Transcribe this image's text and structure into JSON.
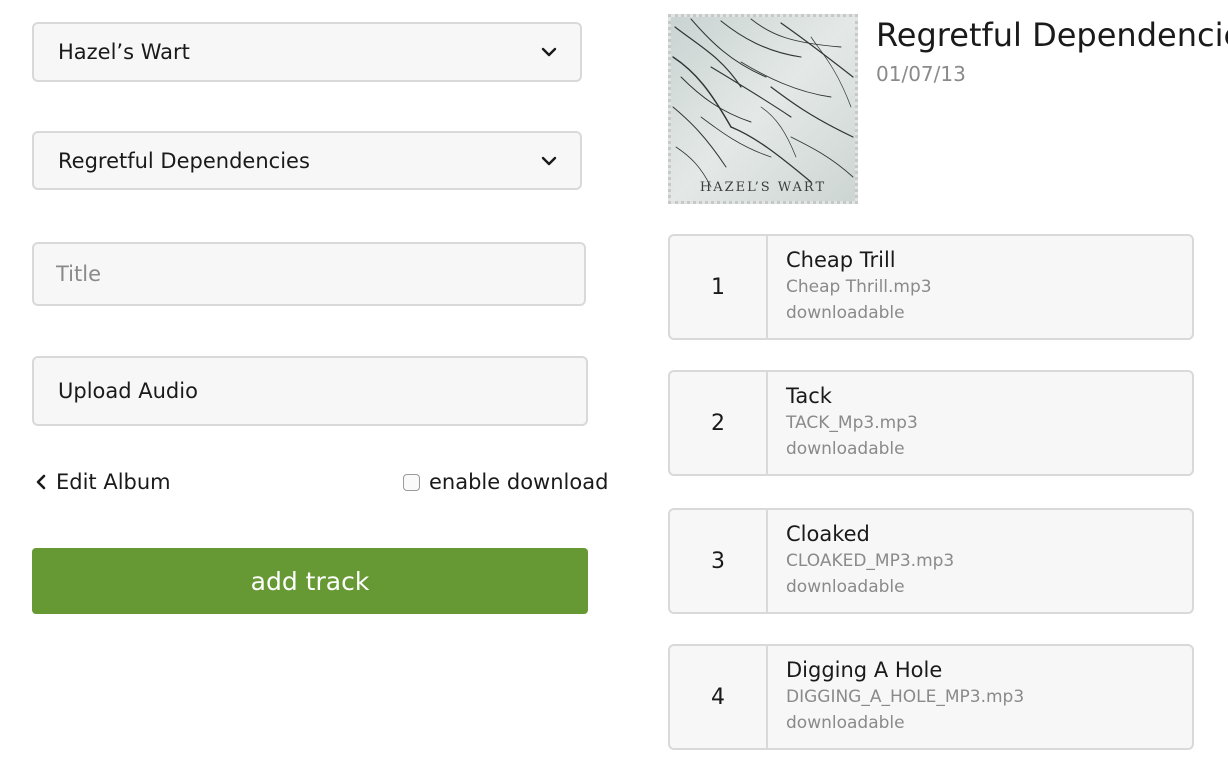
{
  "form": {
    "artist_select": {
      "value": "Hazel’s Wart"
    },
    "album_select": {
      "value": "Regretful Dependencies"
    },
    "title_input": {
      "placeholder": "Title",
      "value": ""
    },
    "upload_label": "Upload Audio",
    "edit_album_label": "Edit Album",
    "enable_download_label": "enable download",
    "enable_download_checked": false,
    "add_track_label": "add track"
  },
  "album": {
    "title": "Regretful Dependencies",
    "date": "01/07/13",
    "cover_text": "HAZEL’S WART"
  },
  "tracks": [
    {
      "number": "1",
      "title": "Cheap Trill",
      "file": "Cheap Thrill.mp3",
      "status": "downloadable"
    },
    {
      "number": "2",
      "title": "Tack",
      "file": "TACK_Mp3.mp3",
      "status": "downloadable"
    },
    {
      "number": "3",
      "title": "Cloaked",
      "file": "CLOAKED_MP3.mp3",
      "status": "downloadable"
    },
    {
      "number": "4",
      "title": "Digging A Hole",
      "file": "DIGGING_A_HOLE_MP3.mp3",
      "status": "downloadable"
    }
  ],
  "colors": {
    "primary_button": "#669933",
    "field_background": "#f7f7f7",
    "border": "#d9d9d9",
    "muted_text": "#8a8a8a"
  },
  "icons": {
    "select_chevron": "chevron-down-icon",
    "back": "chevron-left-icon"
  }
}
